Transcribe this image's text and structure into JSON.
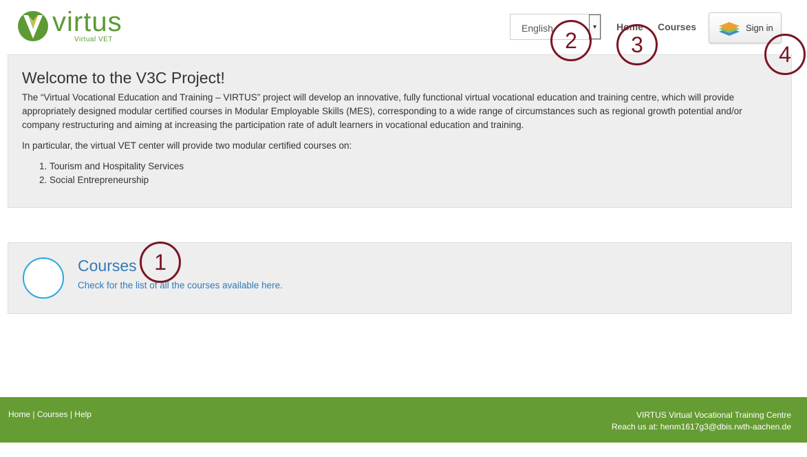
{
  "logo": {
    "name": "virtus",
    "tagline": "Virtual VET",
    "brand_color": "#5d9a35"
  },
  "header": {
    "language": {
      "selected": "English"
    },
    "nav": [
      {
        "label": "Home"
      },
      {
        "label": "Courses"
      }
    ],
    "signin": {
      "label": "Sign in",
      "icon": "layers-icon"
    }
  },
  "welcome": {
    "title": "Welcome to the V3C Project!",
    "paragraph1": "The “Virtual Vocational Education and Training – VIRTUS” project will develop an innovative, fully functional virtual vocational education and training centre, which will provide appropriately designed modular certified courses in Modular Employable Skills (MES), corresponding to a wide range of circumstances such as regional growth potential and/or company restructuring and aiming at increasing the participation rate of adult learners in vocational education and training.",
    "paragraph2": "In particular, the virtual VET center will provide two modular certified courses on:",
    "list": [
      "Tourism and Hospitality Services",
      "Social Entrepreneurship"
    ]
  },
  "courses_card": {
    "title": "Courses",
    "description": "Check for the list of all the courses available here."
  },
  "footer": {
    "links": [
      "Home",
      "Courses",
      "Help"
    ],
    "separator": " | ",
    "org_name": "VIRTUS Virtual Vocational Training Centre",
    "contact": "Reach us at: henm1617g3@dbis.rwth-aachen.de",
    "background": "#659c33"
  },
  "annotations": [
    "1",
    "2",
    "3",
    "4"
  ],
  "colors": {
    "link": "#337ab7",
    "annotation": "#7a1523",
    "circle_border": "#29a8e0"
  }
}
